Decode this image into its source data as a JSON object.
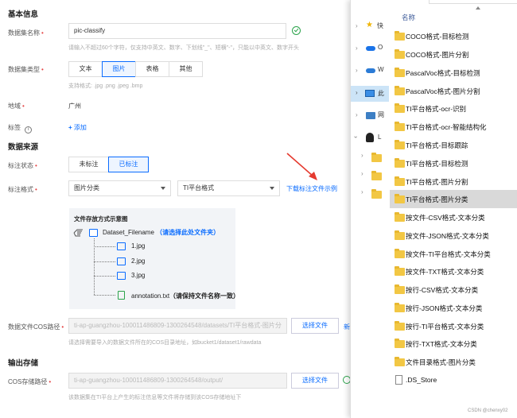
{
  "form": {
    "basic_title": "基本信息",
    "name_label": "数据集名称",
    "name_value": "pic-classify",
    "name_hint": "请输入不超过60个字符，仅支持中英文、数字、下划线\"_\"、短横\"-\"，只能以中英文、数字开头",
    "type_label": "数据集类型",
    "type_tabs": [
      "文本",
      "图片",
      "表格",
      "其他"
    ],
    "type_hint": "支持格式: .jpg .png .jpeg .bmp",
    "region_label": "地域",
    "region_value": "广州",
    "tags_label": "标签",
    "add_label": "添加",
    "source_title": "数据来源",
    "annot_status_label": "标注状态",
    "annot_status_tabs": [
      "未标注",
      "已标注"
    ],
    "annot_format_label": "标注格式",
    "select_task": "图片分类",
    "select_format": "TI平台格式",
    "download_link": "下载标注文件示例",
    "diagram_title": "文件存放方式示意图",
    "root_folder": "Dataset_Filename",
    "root_hint": "（请选择此处文件夹）",
    "files": [
      "1.jpg",
      "2.jpg",
      "3.jpg"
    ],
    "annotation_file": "annotation.txt",
    "annotation_hint": "（请保持文件名称一致）",
    "cos_label": "数据文件COS路径",
    "cos_value": "ti-ap-guangzhou-100011486809-1300264548/datasets/TI平台格式-图片分",
    "select_file_btn": "选择文件",
    "cos_hint": "请选择需要导入的数据文件所在的COS目录地址，如bucket1/dataset1/rawdata",
    "output_title": "输出存储",
    "out_label": "COS存储路径",
    "out_value": "ti-ap-guangzhou-100011486809-1300264548/output/",
    "out_hint": "该数据集在TI平台上产生的标注信息等文件将存储到该COS存储地址下"
  },
  "explorer": {
    "header": "名称",
    "nav_labels": [
      "快",
      "O",
      "W",
      "此",
      "网",
      "L"
    ],
    "items": [
      "COCO格式-目标检测",
      "COCO格式-图片分割",
      "PascalVoc格式-目标检测",
      "PascalVoc格式-图片分割",
      "TI平台格式-ocr-识别",
      "TI平台格式-ocr-智能结构化",
      "TI平台格式-目标跟踪",
      "TI平台格式-目标检测",
      "TI平台格式-图片分割",
      "TI平台格式-图片分类",
      "按文件-CSV格式-文本分类",
      "按文件-JSON格式-文本分类",
      "按文件-TI平台格式-文本分类",
      "按文件-TXT格式-文本分类",
      "按行-CSV格式-文本分类",
      "按行-JSON格式-文本分类",
      "按行-TI平台格式-文本分类",
      "按行-TXT格式-文本分类",
      "文件目录格式-图片分类",
      ".DS_Store"
    ],
    "selected_index": 9
  },
  "watermark": "CSDN @chenxy02",
  "colors": {
    "accent": "#0a6cff",
    "required": "#e54545",
    "success": "#2aa34a",
    "folder": "#f2c744",
    "arrow": "#e53a2f"
  }
}
